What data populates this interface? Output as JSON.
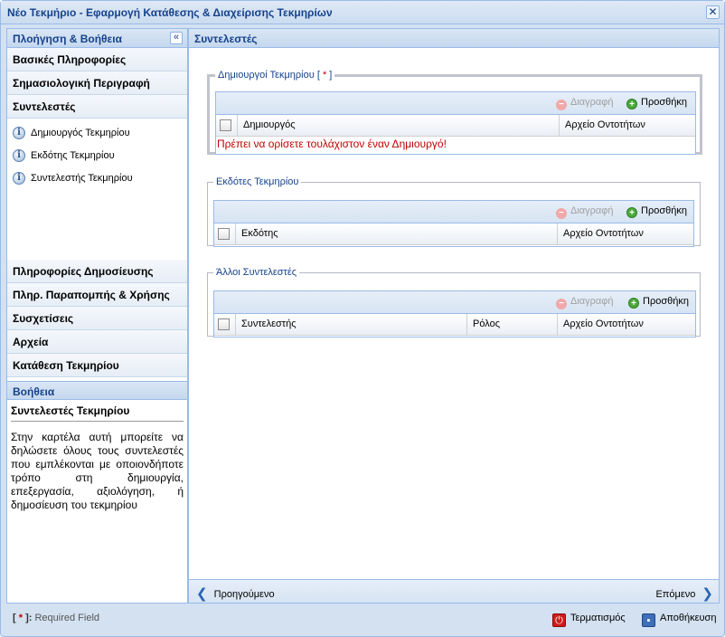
{
  "window": {
    "title": "Νέο Τεκμήριο - Εφαρμογή Κατάθεσης & Διαχείρισης Τεκμηρίων",
    "close_symbol": "✕"
  },
  "nav": {
    "header": "Πλοήγηση & Βοήθεια",
    "collapse_symbol": "«",
    "sections_top": [
      {
        "label": "Βασικές Πληροφορίες"
      },
      {
        "label": "Σημασιολογική Περιγραφή"
      },
      {
        "label": "Συντελεστές"
      }
    ],
    "sub_items": [
      {
        "label": "Δημιουργός Τεκμηρίου",
        "icon": "info-icon"
      },
      {
        "label": "Εκδότης Τεκμηρίου",
        "icon": "info-icon"
      },
      {
        "label": "Συντελεστής Τεκμηρίου",
        "icon": "info-icon"
      }
    ],
    "sections_bottom": [
      {
        "label": "Πληροφορίες Δημοσίευσης"
      },
      {
        "label": "Πληρ. Παραπομπής & Χρήσης"
      },
      {
        "label": "Συσχετίσεις"
      },
      {
        "label": "Αρχεία"
      },
      {
        "label": "Κατάθεση Τεκμηρίου"
      }
    ],
    "help": {
      "header": "Βοήθεια",
      "title": "Συντελεστές Τεκμηρίου",
      "text": "Στην καρτέλα αυτή μπορείτε να δηλώσετε όλους τους συντελεστές που εμπλέκονται με οποιονδήποτε τρόπο στη δημιουργία, επεξεργασία, αξιολόγηση, ή δημοσίευση του τεκμηρίου"
    }
  },
  "main": {
    "header": "Συντελεστές",
    "creators": {
      "legend": "Δημιουργοί Τεκμηρίου",
      "required_open": "[",
      "required_star": "*",
      "required_close": "]",
      "delete_label": "Διαγραφή",
      "add_label": "Προσθήκη",
      "col_name": "Δημιουργός",
      "col_authority": "Αρχείο Οντοτήτων",
      "error": "Πρέπει να ορίσετε τουλάχιστον έναν Δημιουργό!"
    },
    "publishers": {
      "legend": "Εκδότες Τεκμηρίου",
      "delete_label": "Διαγραφή",
      "add_label": "Προσθήκη",
      "col_name": "Εκδότης",
      "col_authority": "Αρχείο Οντοτήτων"
    },
    "contributors": {
      "legend": "Άλλοι Συντελεστές",
      "delete_label": "Διαγραφή",
      "add_label": "Προσθήκη",
      "col_name": "Συντελεστής",
      "col_role": "Ρόλος",
      "col_authority": "Αρχείο Οντοτήτων"
    },
    "footer": {
      "prev": "Προηγούμενο",
      "next": "Επόμενο"
    }
  },
  "bottom": {
    "req_open": "[",
    "req_star": "*",
    "req_close": "]:",
    "req_text": "Required Field",
    "terminate": "Τερματισμός",
    "save": "Αποθήκευση"
  }
}
